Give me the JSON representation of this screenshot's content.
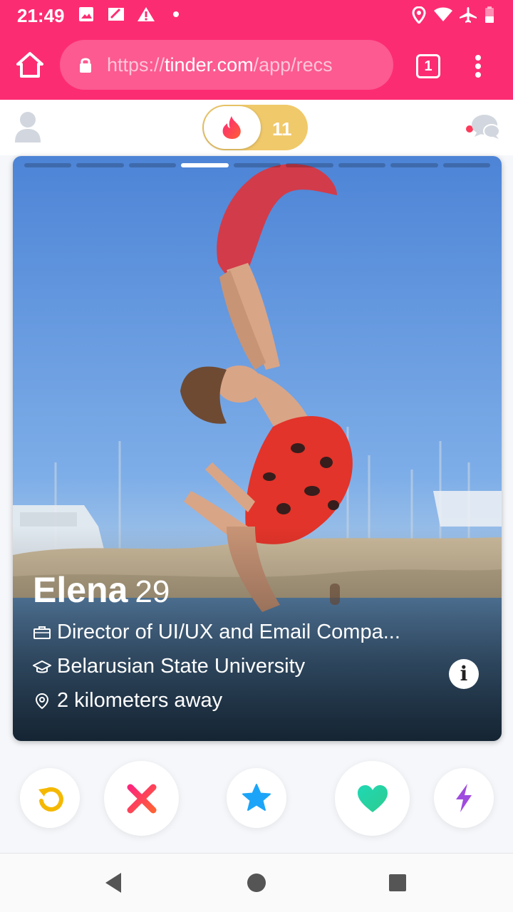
{
  "status_bar": {
    "time": "21:49",
    "icons": [
      "image-icon",
      "sim-icon",
      "warning-icon",
      "dot-icon",
      "location-icon",
      "wifi-icon",
      "airplane-icon",
      "battery-icon"
    ]
  },
  "browser": {
    "url_prefix": "https://",
    "url_domain": "tinder.com",
    "url_path": "/app/recs",
    "tab_count": "1"
  },
  "header": {
    "boost_count": "11"
  },
  "profile": {
    "name": "Elena",
    "age": "29",
    "job": "Director of UI/UX and Email Compa...",
    "school": "Belarusian State University",
    "distance": "2 kilometers away",
    "photo_count": 9,
    "active_photo_index": 3
  },
  "actions": [
    "rewind-button",
    "nope-button",
    "super-like-button",
    "like-button",
    "boost-button"
  ],
  "colors": {
    "brand": "#fc2c73",
    "gold": "#f0c96a",
    "rewind": "#f5b800",
    "nope": "#fd3a5a",
    "super_like": "#1ca5f8",
    "like": "#2de0b0",
    "boost": "#a04bdf"
  }
}
